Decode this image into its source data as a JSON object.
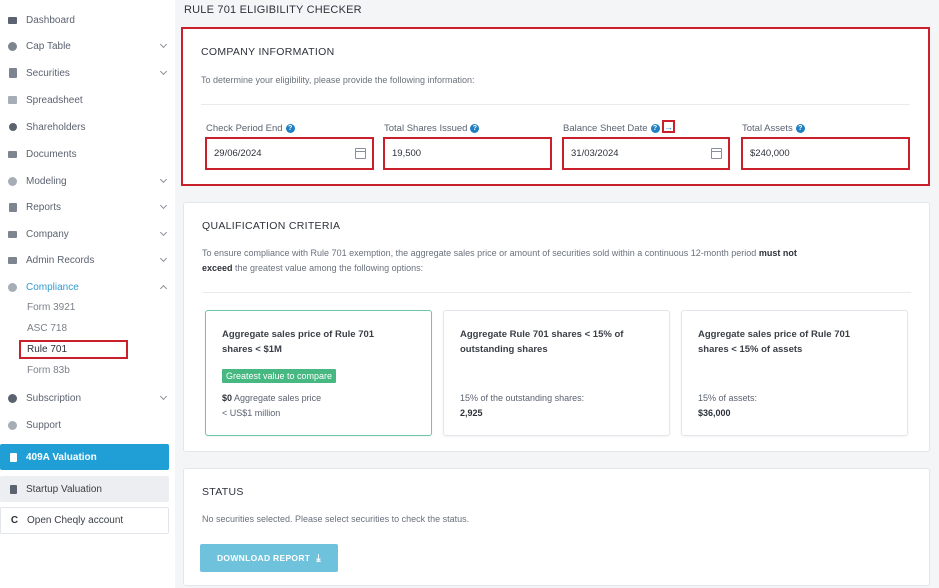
{
  "sidebar": {
    "items": [
      {
        "label": "Dashboard",
        "icon": "dashboard-icon"
      },
      {
        "label": "Cap Table",
        "icon": "pie-chart-icon"
      },
      {
        "label": "Securities",
        "icon": "document-icon"
      },
      {
        "label": "Spreadsheet",
        "icon": "grid-icon"
      },
      {
        "label": "Shareholders",
        "icon": "user-icon"
      },
      {
        "label": "Documents",
        "icon": "folder-icon"
      },
      {
        "label": "Modeling",
        "icon": "bulb-icon"
      },
      {
        "label": "Reports",
        "icon": "report-icon"
      },
      {
        "label": "Company",
        "icon": "building-icon"
      },
      {
        "label": "Admin Records",
        "icon": "records-icon"
      },
      {
        "label": "Compliance",
        "icon": "shield-icon"
      },
      {
        "label": "Subscription",
        "icon": "dollar-icon"
      },
      {
        "label": "Support",
        "icon": "support-icon"
      }
    ],
    "compliance_sub": [
      "Form 3921",
      "ASC 718",
      "Rule 701",
      "Form 83b"
    ],
    "btn_409a": "409A Valuation",
    "btn_startup": "Startup Valuation",
    "btn_cheqly": "Open Cheqly account",
    "accent": "#1f9fd6"
  },
  "page": {
    "title": "RULE 701 ELIGIBILITY CHECKER"
  },
  "company": {
    "title": "COMPANY INFORMATION",
    "desc": "To determine your eligibility, please provide the following information:",
    "fields": [
      {
        "label": "Check Period End",
        "value": "29/06/2024"
      },
      {
        "label": "Total Shares Issued",
        "value": "19,500"
      },
      {
        "label": "Balance Sheet Date",
        "value": "31/03/2024"
      },
      {
        "label": "Total Assets",
        "value": "$240,000"
      }
    ],
    "help": "?"
  },
  "qualification": {
    "title": "QUALIFICATION CRITERIA",
    "desc_pre": "To ensure compliance with Rule 701 exemption, the aggregate sales price or amount of securities sold within a continuous 12-month period ",
    "desc_bold1": "must not",
    "desc_bold2": "exceed",
    "desc_post": " the greatest value among the following options:",
    "options": [
      {
        "title": "Aggregate sales price of Rule 701 shares < $1M",
        "badge": "Greatest value to compare",
        "l1_bold": "$0",
        "l1": " Aggregate sales price",
        "l2": "< US$1 million"
      },
      {
        "title": "Aggregate Rule 701 shares < 15% of outstanding shares",
        "l1": "15% of the outstanding shares:",
        "l2_bold": "2,925"
      },
      {
        "title": "Aggregate sales price of Rule 701 shares < 15% of assets",
        "l1": "15% of assets:",
        "l2_bold": "$36,000"
      }
    ]
  },
  "status": {
    "title": "STATUS",
    "desc": "No securities selected. Please select securities to check the status.",
    "download_label": "DOWNLOAD REPORT"
  }
}
